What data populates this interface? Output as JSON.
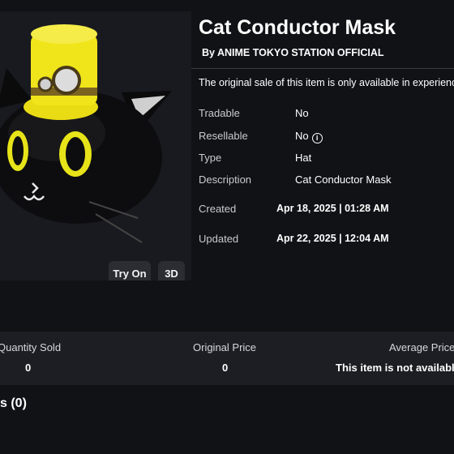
{
  "item": {
    "title": "Cat Conductor Mask",
    "creator": "By ANIME TOKYO STATION OFFICIAL",
    "notice": "The original sale of this item is only available in experiences",
    "image_name": "black cat mask with yellow top hat"
  },
  "preview_buttons": {
    "try_on": "Try On",
    "view_3d": "3D"
  },
  "details": [
    {
      "label": "Tradable",
      "value": "No"
    },
    {
      "label": "Resellable",
      "value": "No"
    },
    {
      "label": "Type",
      "value": "Hat"
    },
    {
      "label": "Description",
      "value": "Cat Conductor Mask"
    },
    {
      "label": "Created",
      "value": "Apr 18, 2025 | 01:28 AM"
    },
    {
      "label": "Updated",
      "value": "Apr 22, 2025 | 12:04 AM"
    }
  ],
  "info_icon": "i",
  "stats": {
    "headers": [
      "Quantity Sold",
      "Original Price",
      "Average Price"
    ],
    "values": [
      "0",
      "0",
      "This item is not available"
    ]
  },
  "owners_heading": "s (0)",
  "colors": {
    "background": "#111216",
    "panel": "#1d1e23",
    "button": "#2b2d33",
    "hat": "#f0e51a"
  }
}
